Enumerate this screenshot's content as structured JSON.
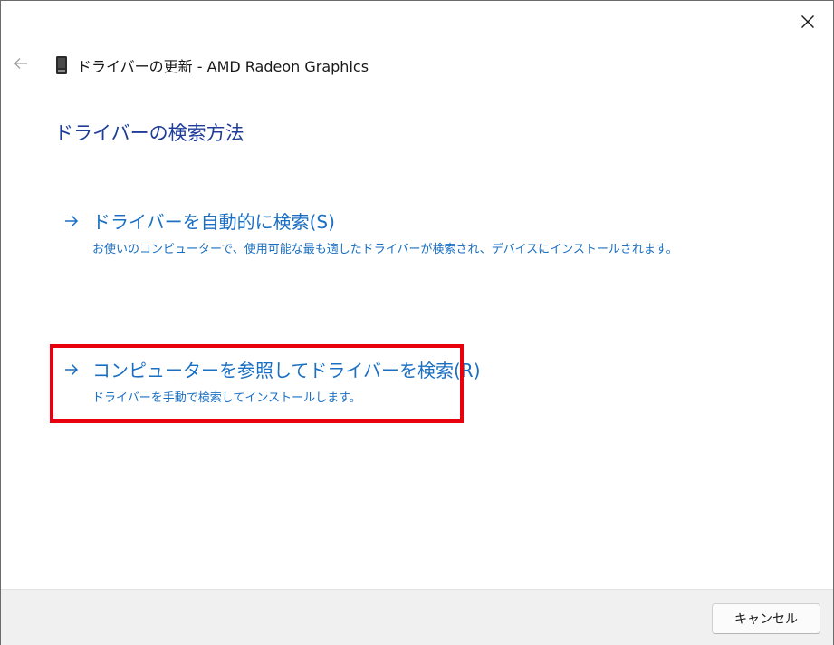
{
  "window": {
    "title": "ドライバーの更新 - AMD Radeon Graphics"
  },
  "heading": "ドライバーの検索方法",
  "options": [
    {
      "title": "ドライバーを自動的に検索(S)",
      "description": "お使いのコンピューターで、使用可能な最も適したドライバーが検索され、デバイスにインストールされます。",
      "icon": "arrow-right-icon"
    },
    {
      "title": "コンピューターを参照してドライバーを検索(R)",
      "description": "ドライバーを手動で検索してインストールします。",
      "icon": "arrow-right-icon",
      "highlighted": true
    }
  ],
  "footer": {
    "cancel_label": "キャンセル"
  },
  "colors": {
    "heading": "#1f3d99",
    "link": "#1a6fc2",
    "highlight_box": "#e8000d",
    "footer_bg": "#f0f0f0"
  },
  "icons": {
    "close": "close-icon",
    "back": "back-arrow-icon",
    "device": "display-adapter-icon"
  }
}
